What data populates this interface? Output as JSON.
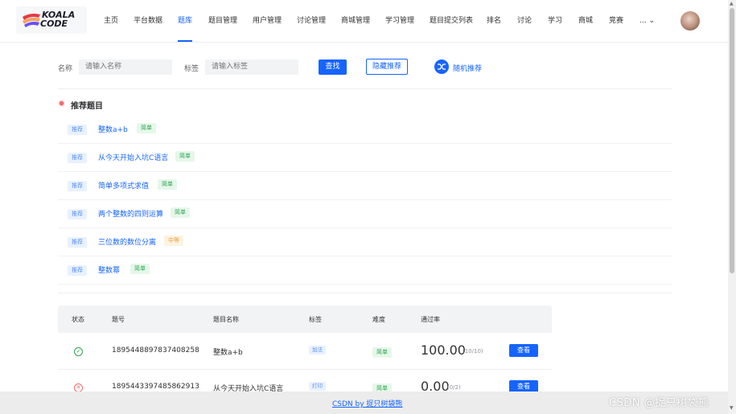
{
  "header": {
    "logo_line1": "KOALA",
    "logo_line2": "CODE",
    "nav": [
      {
        "label": "主页"
      },
      {
        "label": "平台数据"
      },
      {
        "label": "题库"
      },
      {
        "label": "题目管理"
      },
      {
        "label": "用户管理"
      },
      {
        "label": "讨论管理"
      },
      {
        "label": "商城管理"
      },
      {
        "label": "学习管理"
      },
      {
        "label": "题目提交列表"
      },
      {
        "label": "排名"
      },
      {
        "label": "讨论"
      },
      {
        "label": "学习"
      },
      {
        "label": "商城"
      },
      {
        "label": "竞赛"
      },
      {
        "label": "... ⌄"
      }
    ],
    "active_nav": "题库"
  },
  "search": {
    "name_label": "名称",
    "name_placeholder": "请输入名称",
    "tag_label": "标签",
    "tag_placeholder": "请输入标签",
    "search_button": "查找",
    "hide_button": "隐藏推荐",
    "random_label": "随机推荐"
  },
  "recommend": {
    "title": "推荐题目",
    "items": [
      {
        "tag": "推荐",
        "name": "整数a+b",
        "difficulty": "简单",
        "level": "easy"
      },
      {
        "tag": "推荐",
        "name": "从今天开始入坑C语言",
        "difficulty": "简单",
        "level": "easy"
      },
      {
        "tag": "推荐",
        "name": "简单多项式求值",
        "difficulty": "简单",
        "level": "easy"
      },
      {
        "tag": "推荐",
        "name": "两个整数的四则运算",
        "difficulty": "简单",
        "level": "easy"
      },
      {
        "tag": "推荐",
        "name": "三位数的数位分离",
        "difficulty": "中等",
        "level": "mid"
      },
      {
        "tag": "推荐",
        "name": "整数幂",
        "difficulty": "简单",
        "level": "easy"
      }
    ]
  },
  "table": {
    "headers": [
      "状态",
      "题号",
      "题目名称",
      "标签",
      "难度",
      "通过率"
    ],
    "rows": [
      {
        "status": "ok",
        "id": "1895448897837408258",
        "name": "整数a+b",
        "tag": "加法",
        "difficulty": "简单",
        "rate": "100.00",
        "rate_detail": "(10/10)",
        "action": "查看"
      },
      {
        "status": "fail",
        "id": "1895443397485862913",
        "name": "从今天开始入坑C语言",
        "tag": "打印",
        "difficulty": "简单",
        "rate": "0.00",
        "rate_detail": "(0/2)",
        "action": "查看"
      }
    ]
  },
  "footer": {
    "link": "CSDN by 捉只树袋熊"
  },
  "watermark": "CSDN @捉只树袋熊",
  "colors": {
    "primary": "#1664ff",
    "easy": "#2ba44e",
    "medium": "#e8a33b",
    "fail": "#f56c6c"
  }
}
